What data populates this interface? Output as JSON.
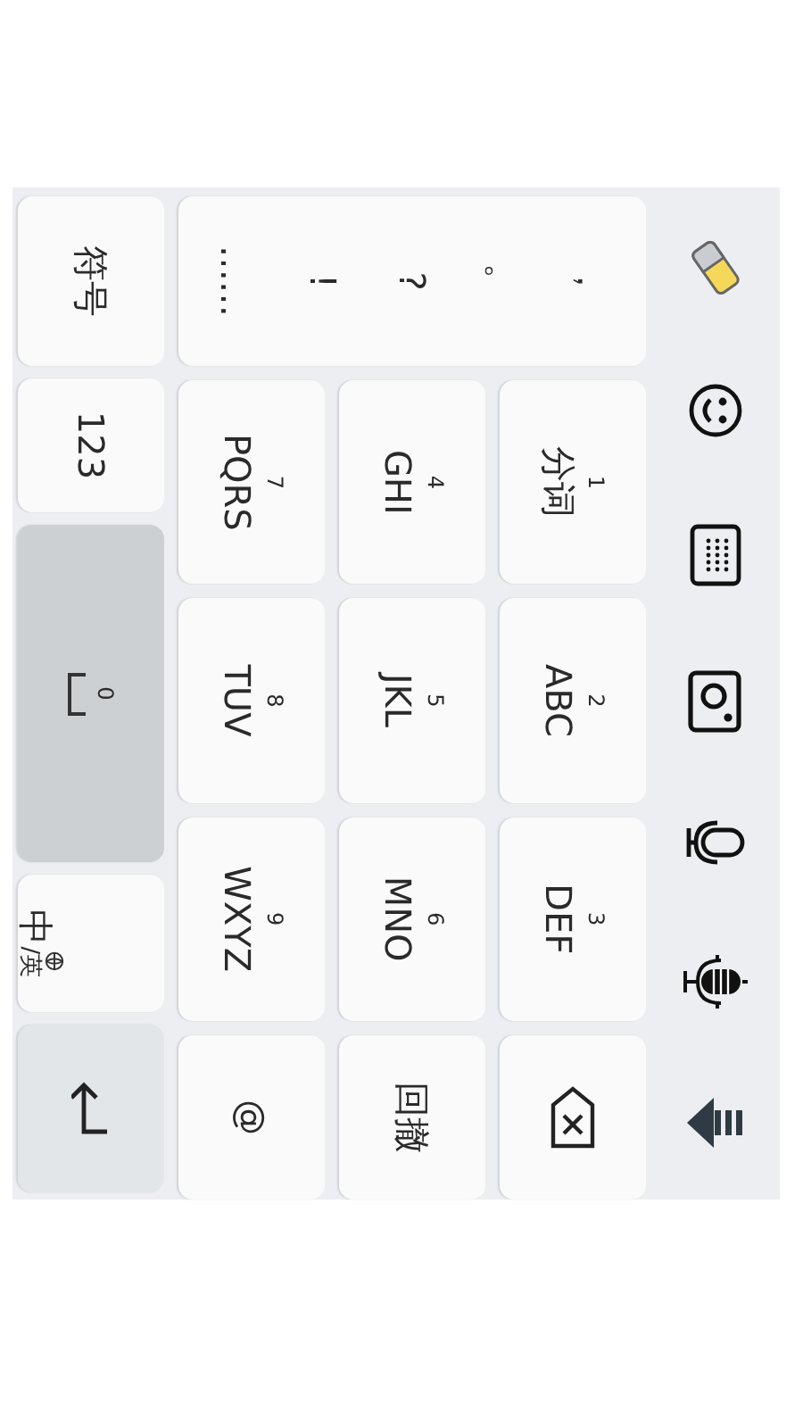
{
  "symbols": [
    "，",
    "。",
    "?",
    "!",
    "……"
  ],
  "keys": [
    {
      "kind": "letters",
      "digit": "1",
      "label": "分词"
    },
    {
      "kind": "letters",
      "digit": "2",
      "label": "ABC"
    },
    {
      "kind": "letters",
      "digit": "3",
      "label": "DEF"
    },
    {
      "kind": "backspace"
    },
    {
      "kind": "letters",
      "digit": "4",
      "label": "GHI"
    },
    {
      "kind": "letters",
      "digit": "5",
      "label": "JKL"
    },
    {
      "kind": "letters",
      "digit": "6",
      "label": "MNO"
    },
    {
      "kind": "text",
      "label": "回撤"
    },
    {
      "kind": "letters",
      "digit": "7",
      "label": "PQRS"
    },
    {
      "kind": "letters",
      "digit": "8",
      "label": "TUV"
    },
    {
      "kind": "letters",
      "digit": "9",
      "label": "WXYZ"
    },
    {
      "kind": "text",
      "label": "@"
    }
  ],
  "bottom_row": [
    {
      "kind": "text",
      "label": "符号"
    },
    {
      "kind": "text",
      "label": "123"
    },
    {
      "kind": "space",
      "digit": "0"
    },
    {
      "kind": "lang",
      "label": "中",
      "sub": "/英"
    },
    {
      "kind": "enter"
    }
  ]
}
